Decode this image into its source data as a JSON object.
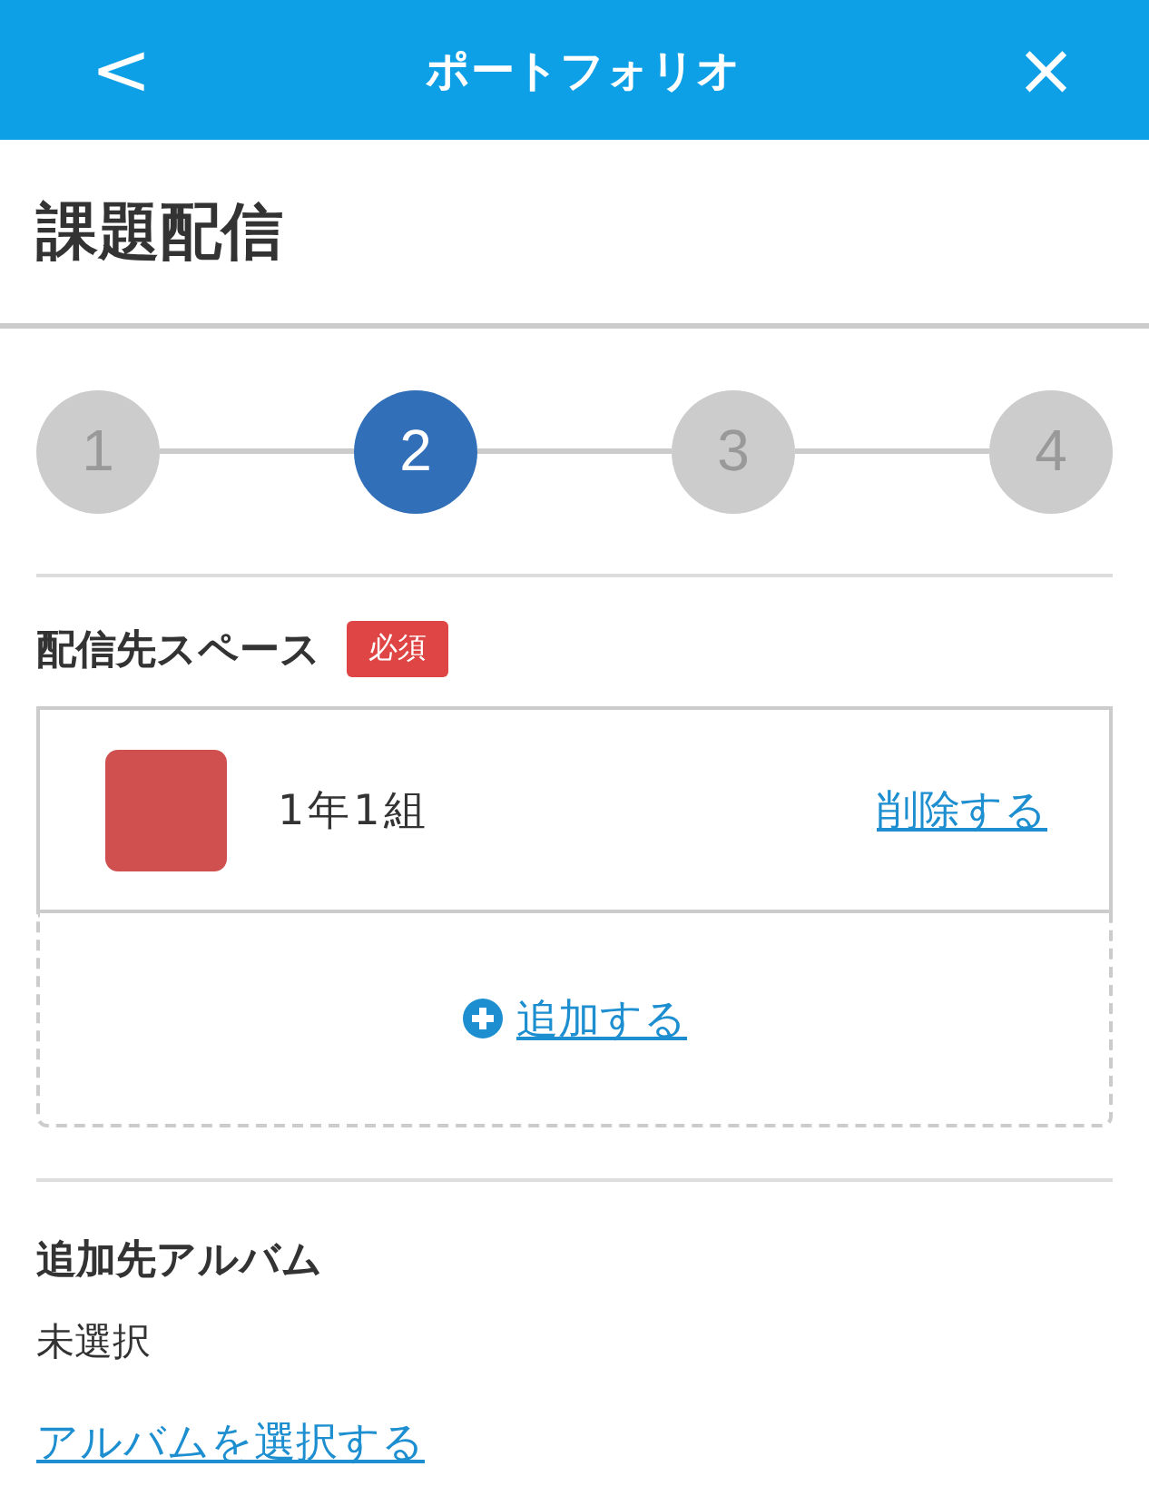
{
  "header": {
    "back": "<",
    "title": "ポートフォリオ",
    "close": "×"
  },
  "page_title": "課題配信",
  "steps": [
    {
      "label": "1",
      "selected": false
    },
    {
      "label": "2",
      "selected": true
    },
    {
      "label": "3",
      "selected": false
    },
    {
      "label": "4",
      "selected": false
    }
  ],
  "destination_space": {
    "label": "配信先スペース",
    "badge": "必須",
    "spaces": [
      {
        "name": "1年1組",
        "color": "#d05050",
        "remove": "削除する"
      }
    ],
    "add": "追加する"
  },
  "album": {
    "label": "追加先アルバム",
    "value": "未選択",
    "select": "アルバムを選択する"
  }
}
